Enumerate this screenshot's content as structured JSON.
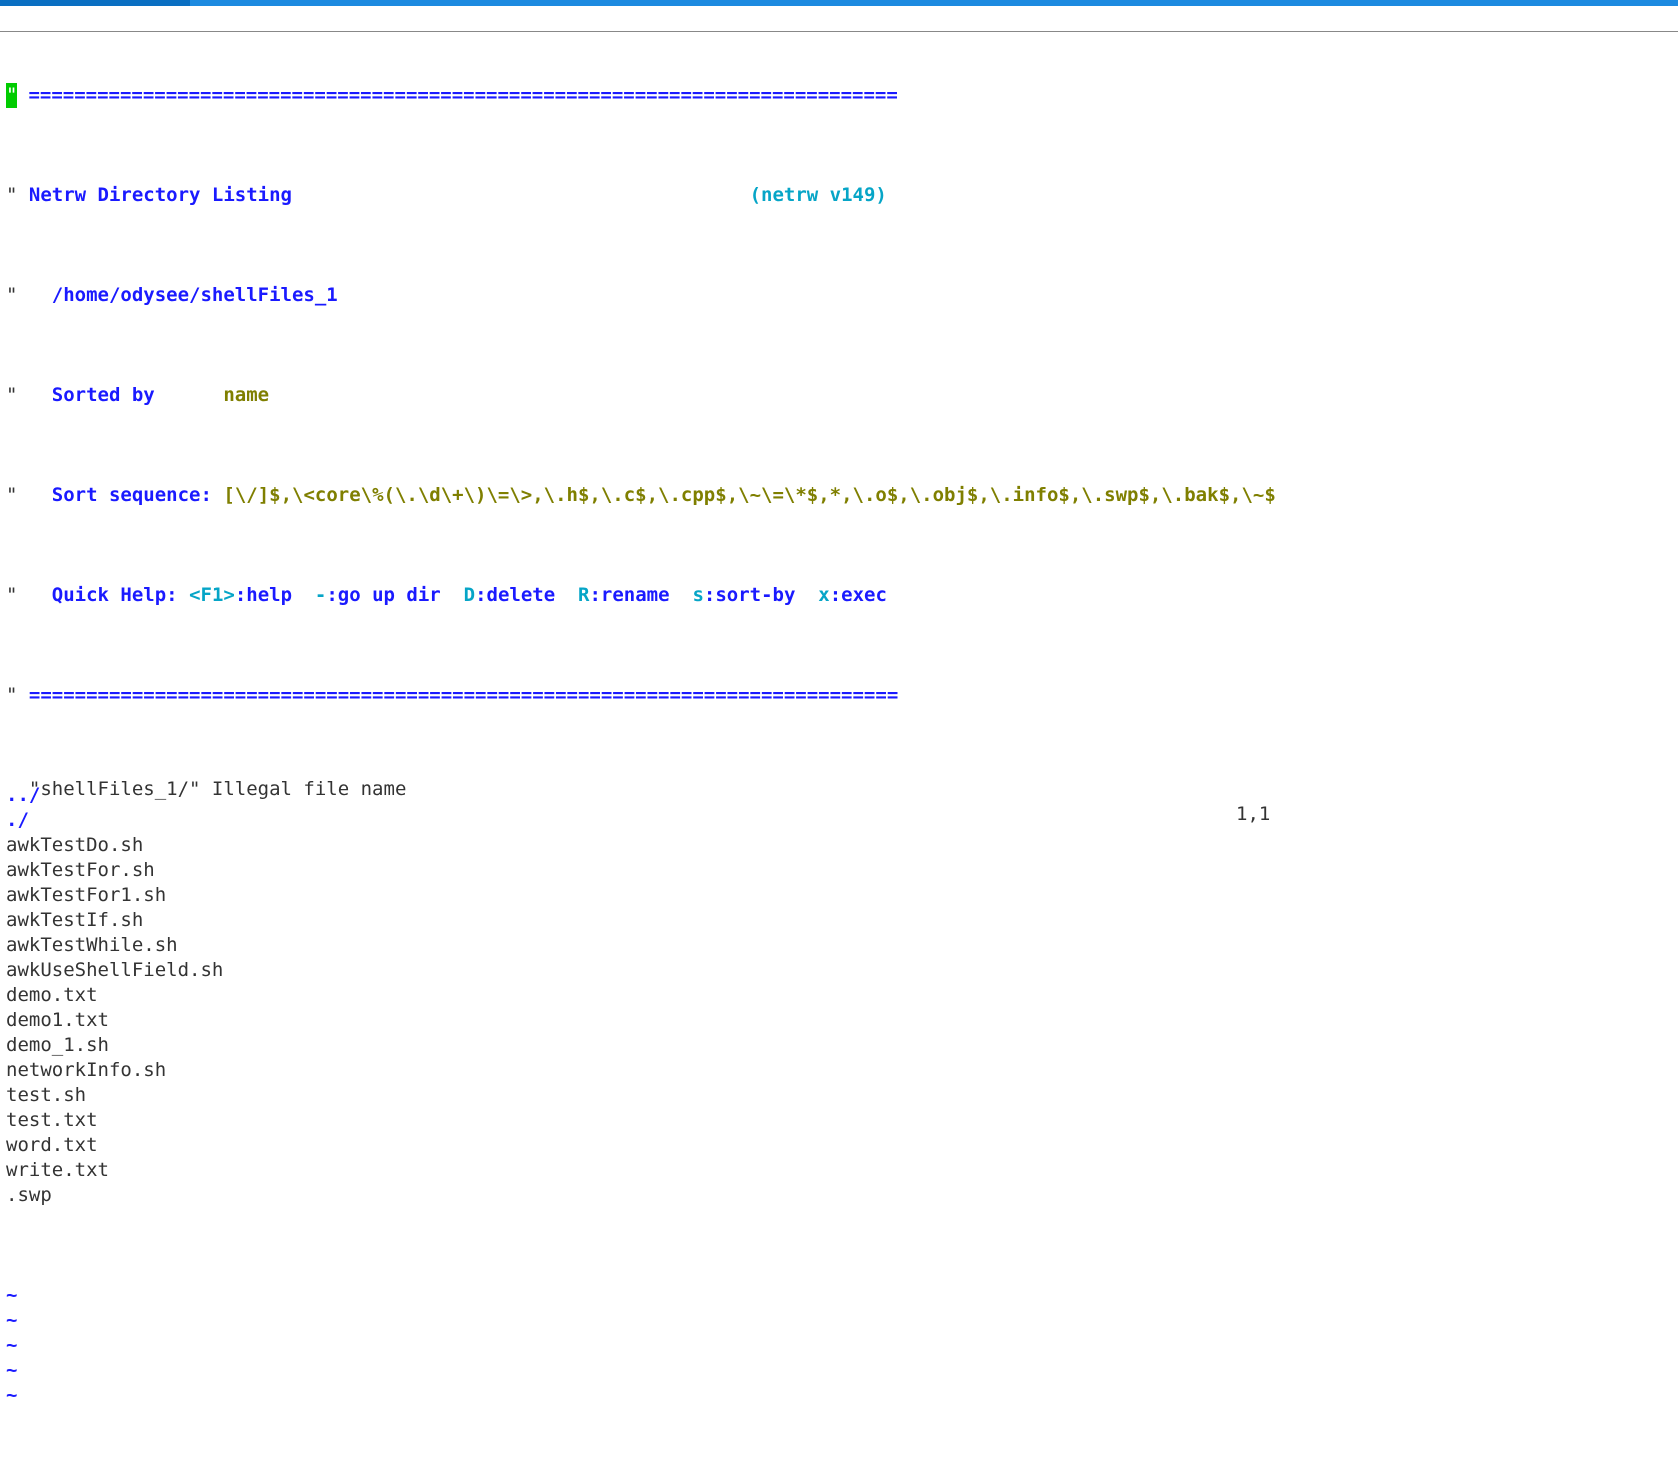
{
  "header": {
    "rule": "============================================================================",
    "title": "Netrw Directory Listing",
    "version": "(netrw v149)",
    "path": "/home/odysee/shellFiles_1",
    "sorted_by_label": "Sorted by",
    "sorted_by_value": "name",
    "sort_seq_label": "Sort sequence:",
    "sort_seq_value": "[\\/]$,\\<core\\%(\\.\\d\\+\\)\\=\\>,\\.h$,\\.c$,\\.cpp$,\\~\\=\\*$,*,\\.o$,\\.obj$,\\.info$,\\.swp$,\\.bak$,\\~$",
    "help_label": "Quick Help:",
    "help_items": [
      {
        "key": "<F1>",
        "desc": ":help"
      },
      {
        "key": "-",
        "desc": ":go up dir"
      },
      {
        "key": "D",
        "desc": ":delete"
      },
      {
        "key": "R",
        "desc": ":rename"
      },
      {
        "key": "s",
        "desc": ":sort-by"
      },
      {
        "key": "x",
        "desc": ":exec"
      }
    ]
  },
  "entries": [
    {
      "name": "../",
      "type": "dir"
    },
    {
      "name": "./",
      "type": "dir"
    },
    {
      "name": "awkTestDo.sh",
      "type": "file"
    },
    {
      "name": "awkTestFor.sh",
      "type": "file"
    },
    {
      "name": "awkTestFor1.sh",
      "type": "file"
    },
    {
      "name": "awkTestIf.sh",
      "type": "file"
    },
    {
      "name": "awkTestWhile.sh",
      "type": "file"
    },
    {
      "name": "awkUseShellField.sh",
      "type": "file"
    },
    {
      "name": "demo.txt",
      "type": "file"
    },
    {
      "name": "demo1.txt",
      "type": "file"
    },
    {
      "name": "demo_1.sh",
      "type": "file"
    },
    {
      "name": "networkInfo.sh",
      "type": "file"
    },
    {
      "name": "test.sh",
      "type": "file"
    },
    {
      "name": "test.txt",
      "type": "file"
    },
    {
      "name": "word.txt",
      "type": "file"
    },
    {
      "name": "write.txt",
      "type": "file"
    },
    {
      "name": ".swp",
      "type": "file"
    }
  ],
  "tilde": "~",
  "tilde_rows": 5,
  "status": {
    "message": "\"shellFiles_1/\" Illegal file name",
    "ruler": "1,1"
  }
}
